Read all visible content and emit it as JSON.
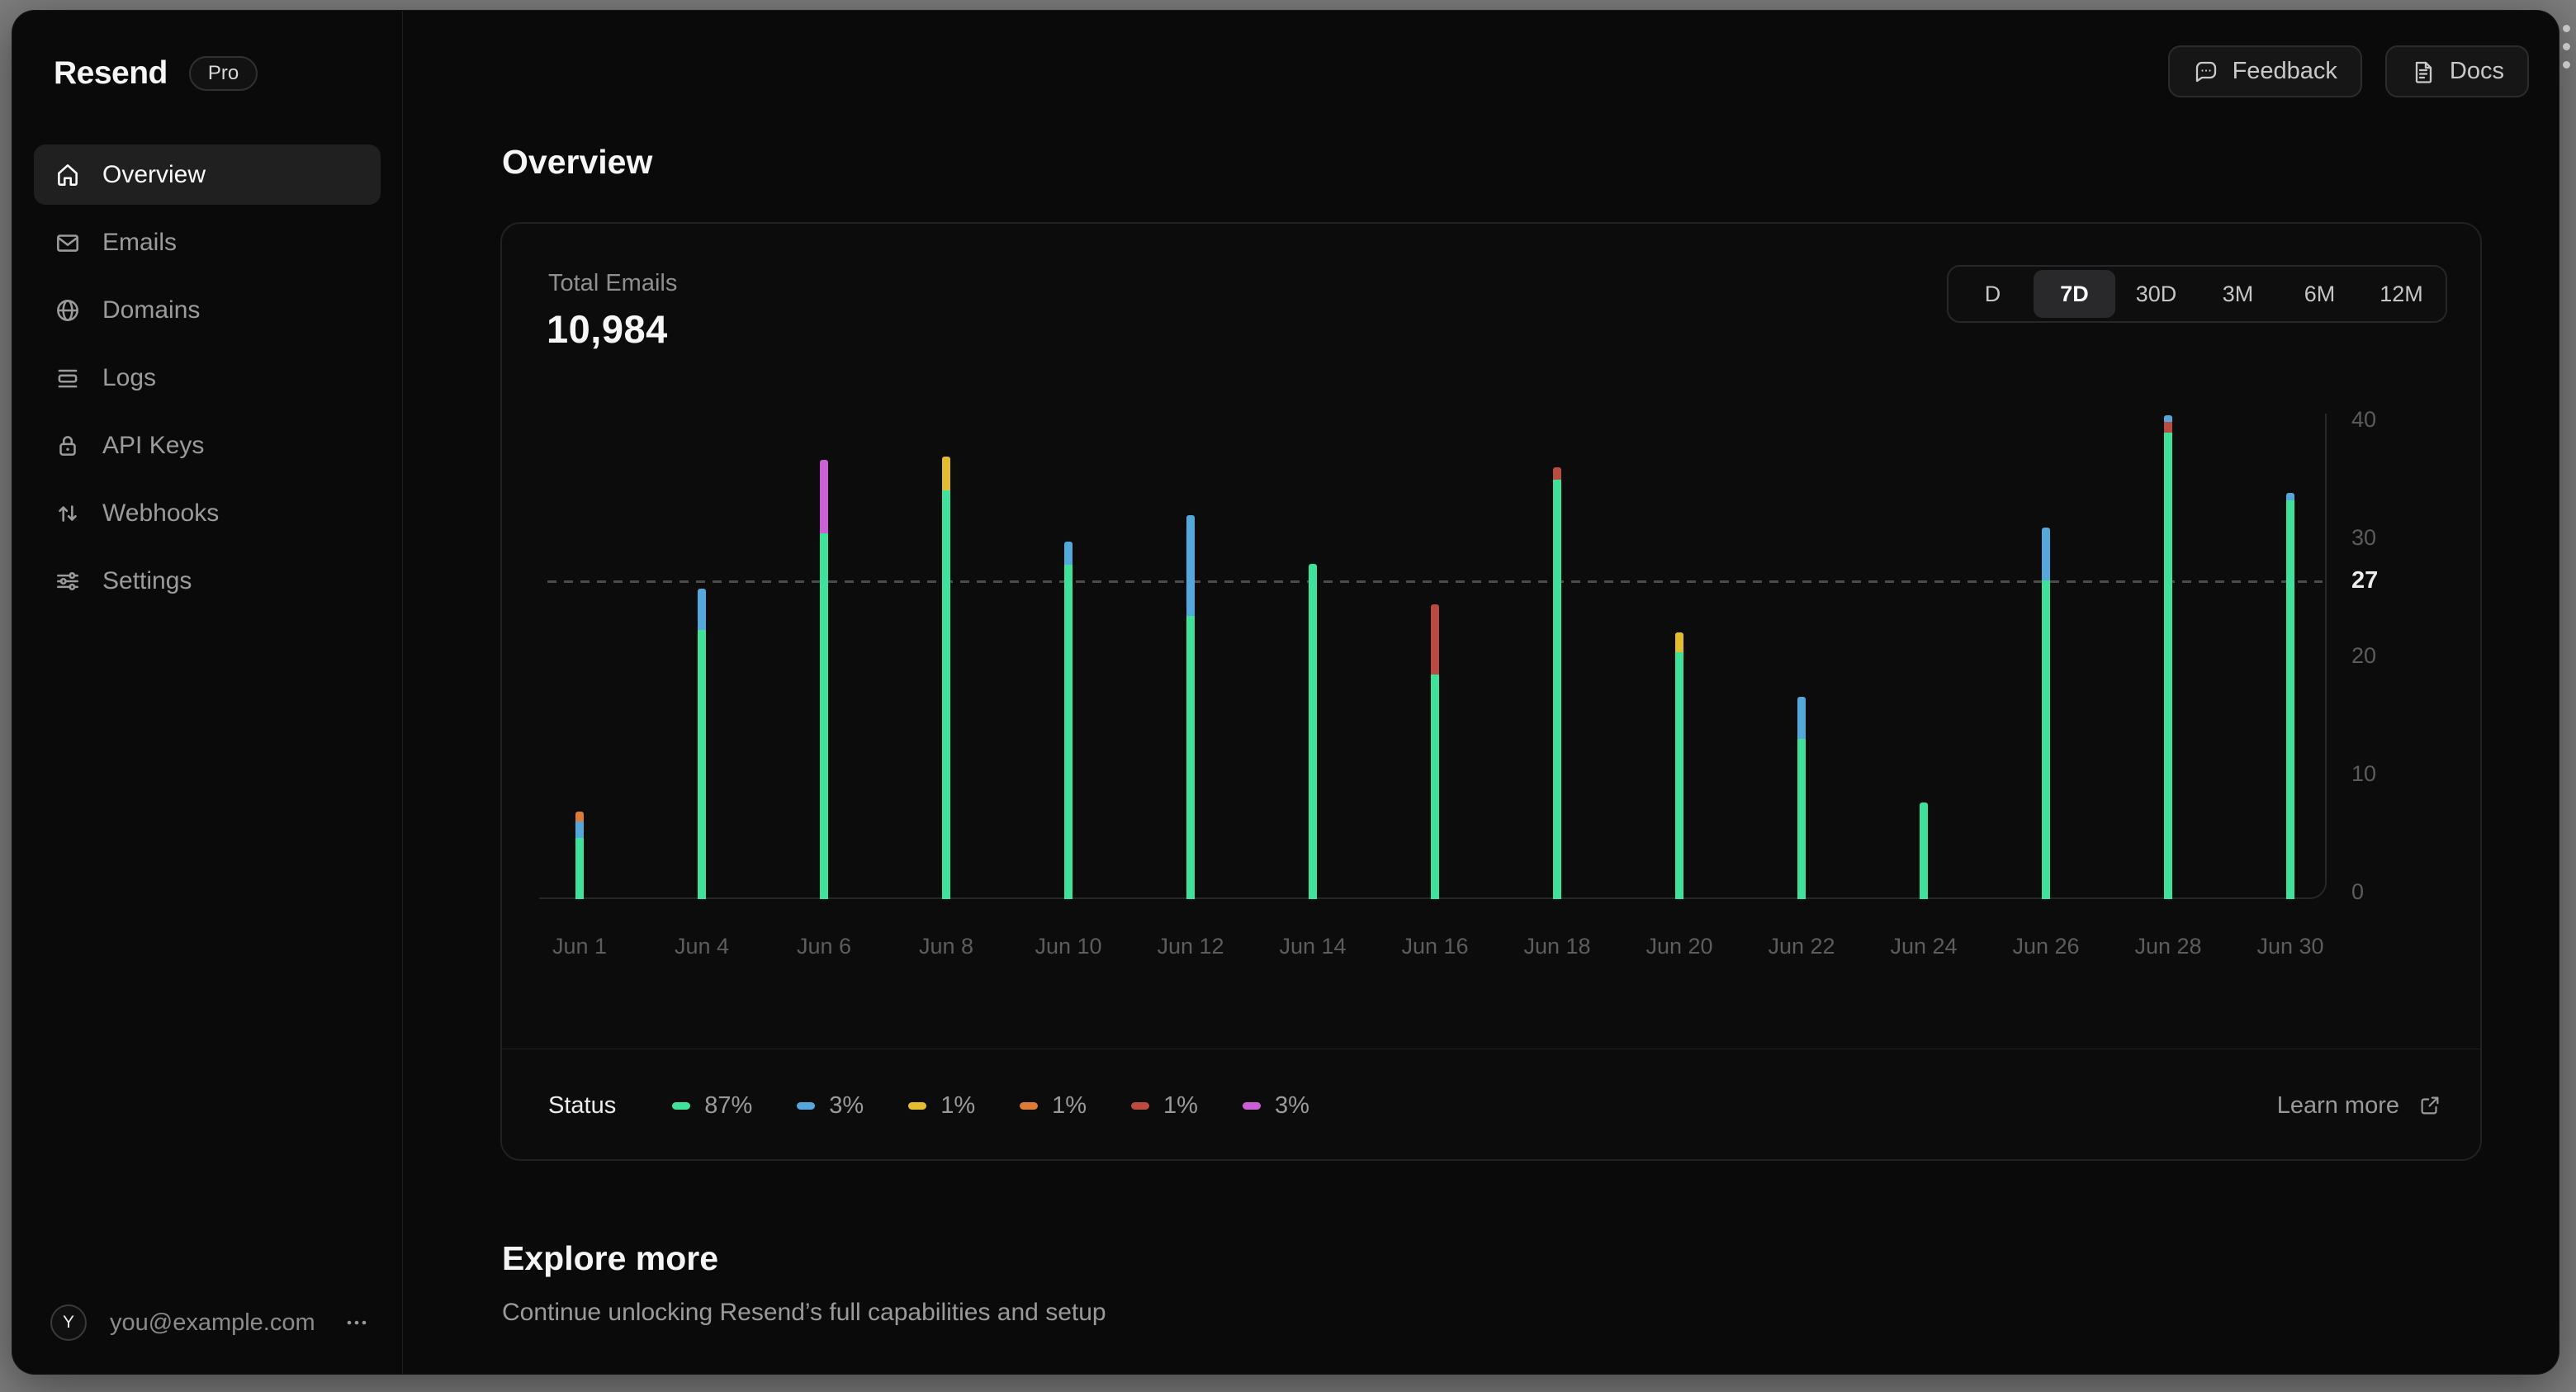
{
  "sidebar": {
    "brand": "Resend",
    "plan_badge": "Pro",
    "items": [
      {
        "label": "Overview"
      },
      {
        "label": "Emails"
      },
      {
        "label": "Domains"
      },
      {
        "label": "Logs"
      },
      {
        "label": "API Keys"
      },
      {
        "label": "Webhooks"
      },
      {
        "label": "Settings"
      }
    ],
    "user": {
      "initial": "Y",
      "email": "you@example.com",
      "menu": "..."
    }
  },
  "topbar": {
    "feedback_label": "Feedback",
    "docs_label": "Docs"
  },
  "page": {
    "title": "Overview"
  },
  "card": {
    "metric_label": "Total Emails",
    "metric_value": "10,984",
    "ranges": [
      "D",
      "7D",
      "30D",
      "3M",
      "6M",
      "12M"
    ],
    "active_range": "7D",
    "legend_title": "Status",
    "learn_more_label": "Learn more"
  },
  "chart_data": {
    "type": "bar",
    "stacked": true,
    "title": "Total Emails",
    "ylim": [
      0,
      42
    ],
    "yticks": [
      0,
      10,
      20,
      30,
      40
    ],
    "highlight_line": 27,
    "grid": "off",
    "legend_position": "bottom",
    "statuses": [
      {
        "name": "green",
        "color": "#3fe29b",
        "percent": "87%"
      },
      {
        "name": "blue",
        "color": "#55a8dc",
        "percent": "3%"
      },
      {
        "name": "yellow",
        "color": "#e4bd2e",
        "percent": "1%"
      },
      {
        "name": "orange",
        "color": "#dd7a36",
        "percent": "1%"
      },
      {
        "name": "red",
        "color": "#bb4b41",
        "percent": "1%"
      },
      {
        "name": "magenta",
        "color": "#cb5fd6",
        "percent": "3%"
      }
    ],
    "categories": [
      "Jun 1",
      "Jun 4",
      "Jun 6",
      "Jun 8",
      "Jun 10",
      "Jun 12",
      "Jun 14",
      "Jun 16",
      "Jun 18",
      "Jun 20",
      "Jun 22",
      "Jun 24",
      "Jun 26",
      "Jun 28",
      "Jun 30"
    ],
    "bars": [
      {
        "label": "Jun 1",
        "segments": [
          [
            "green",
            5.2
          ],
          [
            "blue",
            1.4
          ],
          [
            "orange",
            0.8
          ]
        ]
      },
      {
        "label": "Jun 4",
        "segments": [
          [
            "green",
            22.8
          ],
          [
            "blue",
            3.5
          ]
        ]
      },
      {
        "label": "Jun 6",
        "segments": [
          [
            "green",
            31.0
          ],
          [
            "magenta",
            6.2
          ]
        ]
      },
      {
        "label": "Jun 8",
        "segments": [
          [
            "green",
            34.6
          ],
          [
            "yellow",
            2.9
          ]
        ]
      },
      {
        "label": "Jun 10",
        "segments": [
          [
            "green",
            28.3
          ],
          [
            "blue",
            2.0
          ]
        ]
      },
      {
        "label": "Jun 12",
        "segments": [
          [
            "green",
            24.0
          ],
          [
            "blue",
            8.5
          ]
        ]
      },
      {
        "label": "Jun 14",
        "segments": [
          [
            "green",
            28.4
          ]
        ]
      },
      {
        "label": "Jun 16",
        "segments": [
          [
            "green",
            19.0
          ],
          [
            "red",
            6.0
          ]
        ]
      },
      {
        "label": "Jun 18",
        "segments": [
          [
            "green",
            35.5
          ],
          [
            "red",
            1.1
          ]
        ]
      },
      {
        "label": "Jun 20",
        "segments": [
          [
            "green",
            20.9
          ],
          [
            "yellow",
            1.7
          ]
        ]
      },
      {
        "label": "Jun 22",
        "segments": [
          [
            "green",
            13.6
          ],
          [
            "blue",
            3.5
          ]
        ]
      },
      {
        "label": "Jun 24",
        "segments": [
          [
            "green",
            8.2
          ]
        ]
      },
      {
        "label": "Jun 26",
        "segments": [
          [
            "green",
            27.0
          ],
          [
            "blue",
            4.5
          ]
        ]
      },
      {
        "label": "Jun 28",
        "segments": [
          [
            "green",
            39.5
          ],
          [
            "red",
            0.9
          ],
          [
            "blue",
            0.6
          ]
        ]
      },
      {
        "label": "Jun 30",
        "segments": [
          [
            "green",
            33.8
          ],
          [
            "blue",
            0.6
          ]
        ]
      }
    ]
  },
  "explore": {
    "title": "Explore more",
    "subtitle": "Continue unlocking Resend’s full capabilities and setup"
  }
}
